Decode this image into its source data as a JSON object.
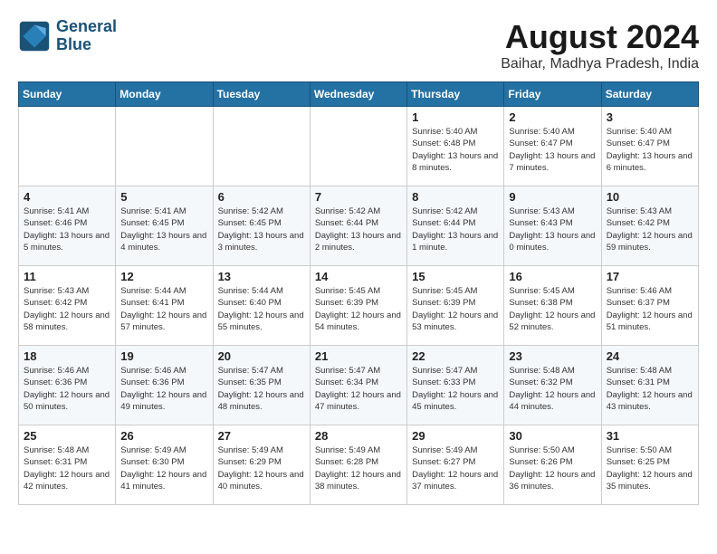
{
  "header": {
    "logo_line1": "General",
    "logo_line2": "Blue",
    "month": "August 2024",
    "location": "Baihar, Madhya Pradesh, India"
  },
  "weekdays": [
    "Sunday",
    "Monday",
    "Tuesday",
    "Wednesday",
    "Thursday",
    "Friday",
    "Saturday"
  ],
  "weeks": [
    [
      {
        "day": "",
        "detail": ""
      },
      {
        "day": "",
        "detail": ""
      },
      {
        "day": "",
        "detail": ""
      },
      {
        "day": "",
        "detail": ""
      },
      {
        "day": "1",
        "detail": "Sunrise: 5:40 AM\nSunset: 6:48 PM\nDaylight: 13 hours\nand 8 minutes."
      },
      {
        "day": "2",
        "detail": "Sunrise: 5:40 AM\nSunset: 6:47 PM\nDaylight: 13 hours\nand 7 minutes."
      },
      {
        "day": "3",
        "detail": "Sunrise: 5:40 AM\nSunset: 6:47 PM\nDaylight: 13 hours\nand 6 minutes."
      }
    ],
    [
      {
        "day": "4",
        "detail": "Sunrise: 5:41 AM\nSunset: 6:46 PM\nDaylight: 13 hours\nand 5 minutes."
      },
      {
        "day": "5",
        "detail": "Sunrise: 5:41 AM\nSunset: 6:45 PM\nDaylight: 13 hours\nand 4 minutes."
      },
      {
        "day": "6",
        "detail": "Sunrise: 5:42 AM\nSunset: 6:45 PM\nDaylight: 13 hours\nand 3 minutes."
      },
      {
        "day": "7",
        "detail": "Sunrise: 5:42 AM\nSunset: 6:44 PM\nDaylight: 13 hours\nand 2 minutes."
      },
      {
        "day": "8",
        "detail": "Sunrise: 5:42 AM\nSunset: 6:44 PM\nDaylight: 13 hours\nand 1 minute."
      },
      {
        "day": "9",
        "detail": "Sunrise: 5:43 AM\nSunset: 6:43 PM\nDaylight: 13 hours\nand 0 minutes."
      },
      {
        "day": "10",
        "detail": "Sunrise: 5:43 AM\nSunset: 6:42 PM\nDaylight: 12 hours\nand 59 minutes."
      }
    ],
    [
      {
        "day": "11",
        "detail": "Sunrise: 5:43 AM\nSunset: 6:42 PM\nDaylight: 12 hours\nand 58 minutes."
      },
      {
        "day": "12",
        "detail": "Sunrise: 5:44 AM\nSunset: 6:41 PM\nDaylight: 12 hours\nand 57 minutes."
      },
      {
        "day": "13",
        "detail": "Sunrise: 5:44 AM\nSunset: 6:40 PM\nDaylight: 12 hours\nand 55 minutes."
      },
      {
        "day": "14",
        "detail": "Sunrise: 5:45 AM\nSunset: 6:39 PM\nDaylight: 12 hours\nand 54 minutes."
      },
      {
        "day": "15",
        "detail": "Sunrise: 5:45 AM\nSunset: 6:39 PM\nDaylight: 12 hours\nand 53 minutes."
      },
      {
        "day": "16",
        "detail": "Sunrise: 5:45 AM\nSunset: 6:38 PM\nDaylight: 12 hours\nand 52 minutes."
      },
      {
        "day": "17",
        "detail": "Sunrise: 5:46 AM\nSunset: 6:37 PM\nDaylight: 12 hours\nand 51 minutes."
      }
    ],
    [
      {
        "day": "18",
        "detail": "Sunrise: 5:46 AM\nSunset: 6:36 PM\nDaylight: 12 hours\nand 50 minutes."
      },
      {
        "day": "19",
        "detail": "Sunrise: 5:46 AM\nSunset: 6:36 PM\nDaylight: 12 hours\nand 49 minutes."
      },
      {
        "day": "20",
        "detail": "Sunrise: 5:47 AM\nSunset: 6:35 PM\nDaylight: 12 hours\nand 48 minutes."
      },
      {
        "day": "21",
        "detail": "Sunrise: 5:47 AM\nSunset: 6:34 PM\nDaylight: 12 hours\nand 47 minutes."
      },
      {
        "day": "22",
        "detail": "Sunrise: 5:47 AM\nSunset: 6:33 PM\nDaylight: 12 hours\nand 45 minutes."
      },
      {
        "day": "23",
        "detail": "Sunrise: 5:48 AM\nSunset: 6:32 PM\nDaylight: 12 hours\nand 44 minutes."
      },
      {
        "day": "24",
        "detail": "Sunrise: 5:48 AM\nSunset: 6:31 PM\nDaylight: 12 hours\nand 43 minutes."
      }
    ],
    [
      {
        "day": "25",
        "detail": "Sunrise: 5:48 AM\nSunset: 6:31 PM\nDaylight: 12 hours\nand 42 minutes."
      },
      {
        "day": "26",
        "detail": "Sunrise: 5:49 AM\nSunset: 6:30 PM\nDaylight: 12 hours\nand 41 minutes."
      },
      {
        "day": "27",
        "detail": "Sunrise: 5:49 AM\nSunset: 6:29 PM\nDaylight: 12 hours\nand 40 minutes."
      },
      {
        "day": "28",
        "detail": "Sunrise: 5:49 AM\nSunset: 6:28 PM\nDaylight: 12 hours\nand 38 minutes."
      },
      {
        "day": "29",
        "detail": "Sunrise: 5:49 AM\nSunset: 6:27 PM\nDaylight: 12 hours\nand 37 minutes."
      },
      {
        "day": "30",
        "detail": "Sunrise: 5:50 AM\nSunset: 6:26 PM\nDaylight: 12 hours\nand 36 minutes."
      },
      {
        "day": "31",
        "detail": "Sunrise: 5:50 AM\nSunset: 6:25 PM\nDaylight: 12 hours\nand 35 minutes."
      }
    ]
  ]
}
